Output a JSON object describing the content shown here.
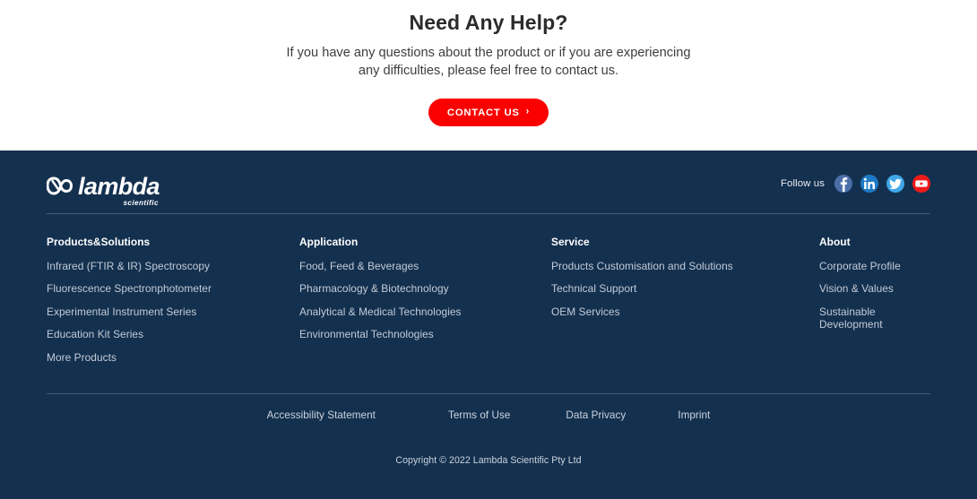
{
  "help": {
    "title": "Need Any Help?",
    "description": "If you have any questions about the product or if you are experiencing any difficulties, please feel free to contact us.",
    "cta_label": "CONTACT US",
    "cta_chevron": "›",
    "cta_color": "#fb0000"
  },
  "footer": {
    "background": "#14304f",
    "logo": {
      "word": "lambda",
      "subtitle": "scientific",
      "mark": "infinity-lambda-mark"
    },
    "social": {
      "label": "Follow us",
      "items": [
        {
          "name": "facebook",
          "glyph": "f",
          "color": "#4a6fa8"
        },
        {
          "name": "linkedin",
          "glyph": "in",
          "color": "#1e79c4"
        },
        {
          "name": "twitter",
          "glyph": "bird",
          "color": "#40a7e8"
        },
        {
          "name": "youtube",
          "glyph": "play",
          "color": "#ef1b1b"
        }
      ]
    },
    "columns": [
      {
        "title": "Products&Solutions",
        "links": [
          "Infrared (FTIR & IR) Spectroscopy",
          "Fluorescence Spectronphotometer",
          "Experimental Instrument Series",
          "Education Kit Series",
          "More Products"
        ]
      },
      {
        "title": "Application",
        "links": [
          "Food, Feed & Beverages",
          "Pharmacology & Biotechnology",
          "Analytical & Medical Technologies",
          "Environmental Technologies"
        ]
      },
      {
        "title": "Service",
        "links": [
          "Products Customisation and Solutions",
          "Technical Support",
          "OEM Services"
        ]
      },
      {
        "title": "About",
        "links": [
          "Corporate Profile",
          "Vision & Values",
          "Sustainable Development"
        ]
      }
    ],
    "legal_links": [
      "Accessibility Statement",
      "Terms of Use",
      "Data Privacy",
      "Imprint"
    ],
    "copyright": "Copyright © 2022 Lambda Scientific Pty Ltd"
  }
}
